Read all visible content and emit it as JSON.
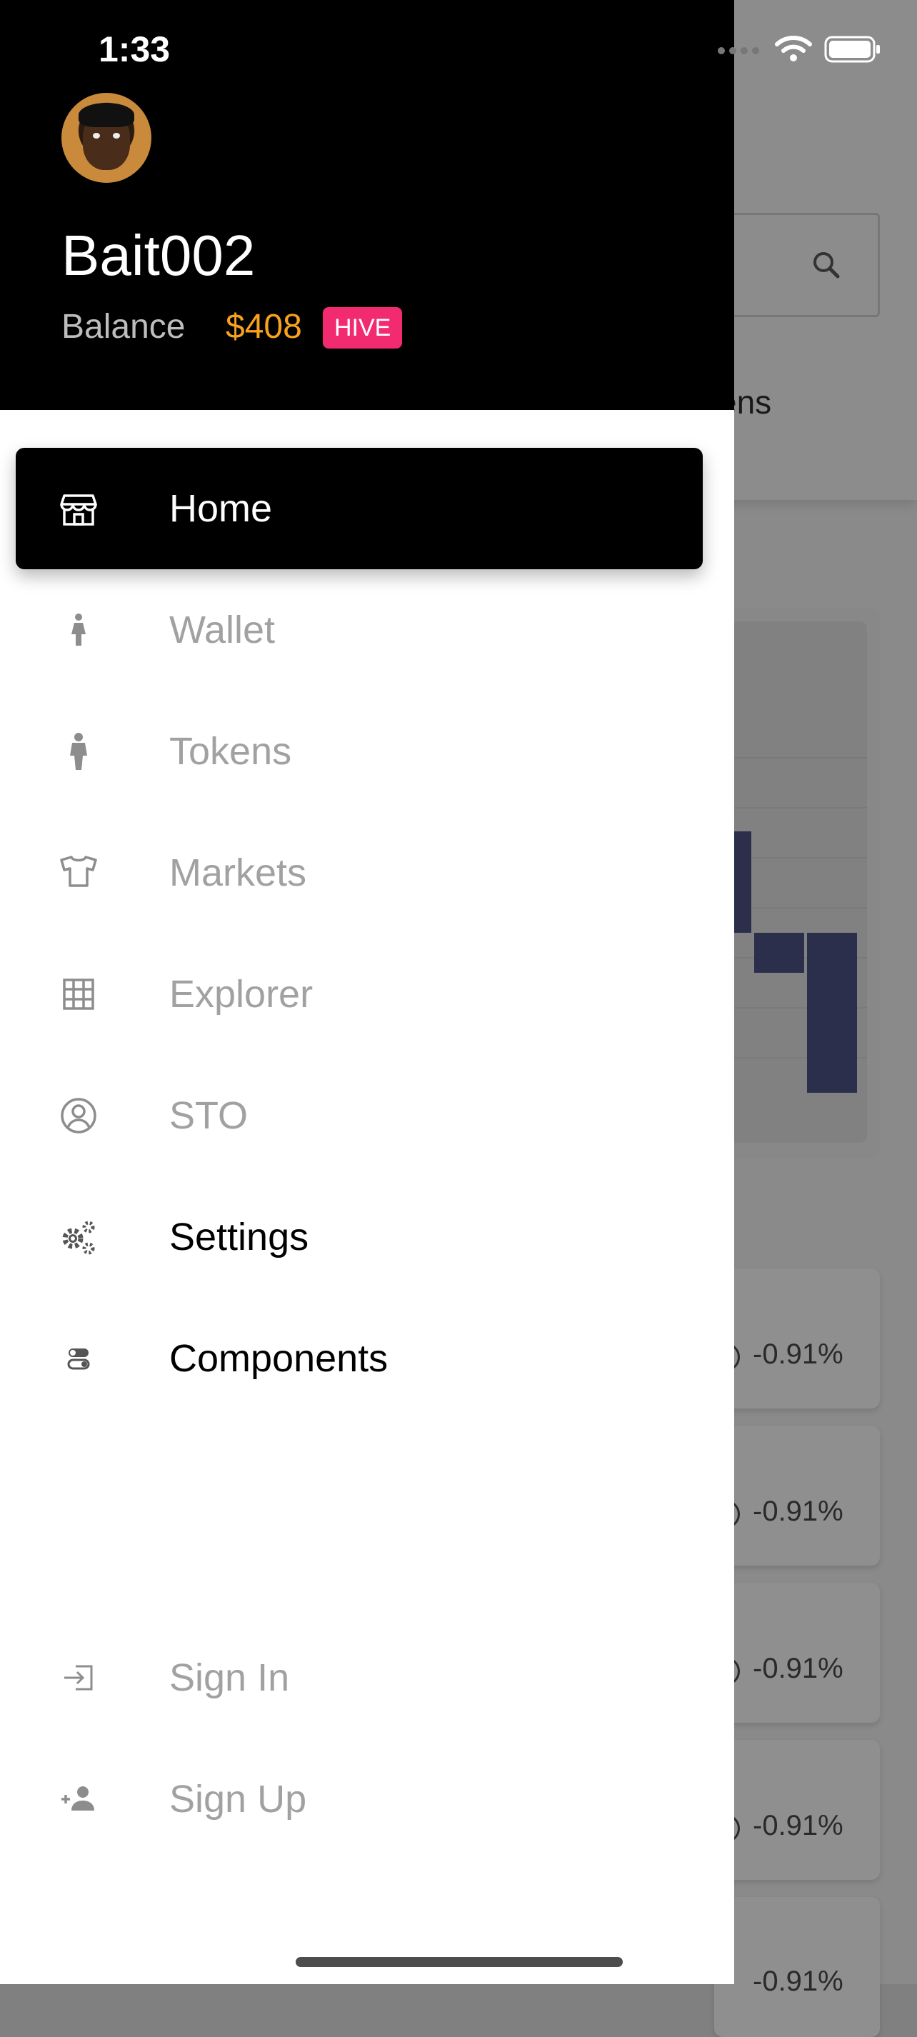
{
  "status_bar": {
    "time": "1:33"
  },
  "profile": {
    "username": "Bait002",
    "balance_label": "Balance",
    "balance_value": "$408",
    "currency_badge": "HIVE"
  },
  "menu": {
    "primary": [
      {
        "label": "Home",
        "icon": "store-icon",
        "active": true
      },
      {
        "label": "Wallet",
        "icon": "woman-icon"
      },
      {
        "label": "Tokens",
        "icon": "man-icon"
      },
      {
        "label": "Markets",
        "icon": "shirt-icon"
      },
      {
        "label": "Explorer",
        "icon": "grid-icon"
      },
      {
        "label": "STO",
        "icon": "user-circle-icon"
      },
      {
        "label": "Settings",
        "icon": "gears-icon"
      },
      {
        "label": "Components",
        "icon": "toggles-icon"
      }
    ],
    "secondary": [
      {
        "label": "Sign In",
        "icon": "sign-in-icon"
      },
      {
        "label": "Sign Up",
        "icon": "add-user-icon"
      }
    ]
  },
  "background": {
    "tab_fragment": "ens",
    "changes": [
      "-0.91%",
      "-0.91%",
      "-0.91%",
      "-0.91%",
      "-0.91%"
    ]
  },
  "colors": {
    "accent_orange": "#f7a21e",
    "badge_pink": "#f22a70",
    "chart_bar": "#2c2f4c"
  }
}
